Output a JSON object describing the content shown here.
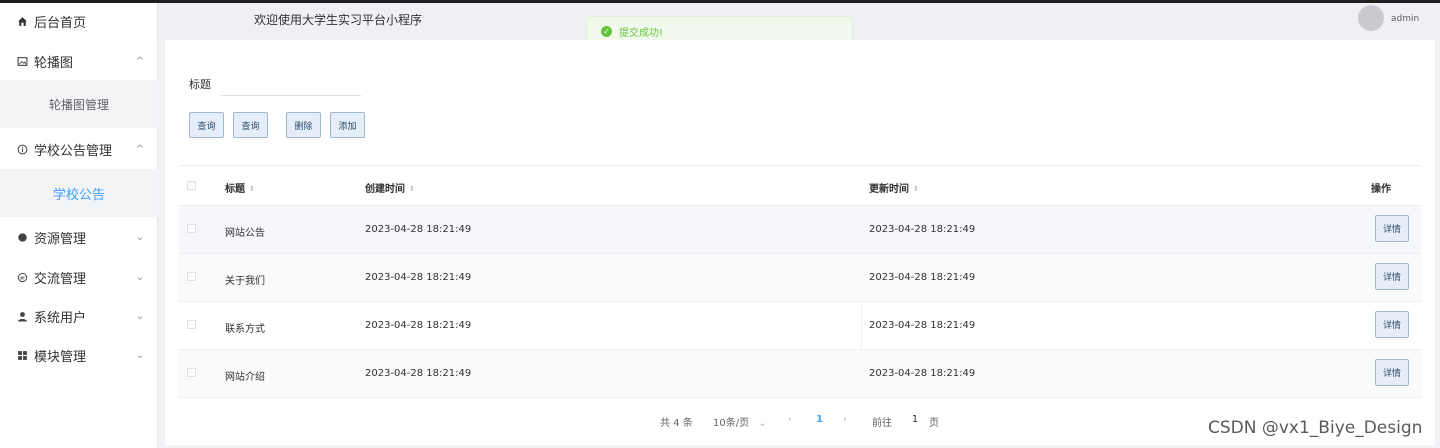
{
  "sidebar": {
    "items": [
      {
        "label": "后台首页",
        "icon": "home-icon"
      },
      {
        "label": "轮播图",
        "icon": "image-icon"
      },
      {
        "label": "轮播图管理"
      },
      {
        "label": "学校公告管理",
        "icon": "info-icon"
      },
      {
        "label": "学校公告"
      },
      {
        "label": "资源管理",
        "icon": "resource-icon"
      },
      {
        "label": "交流管理",
        "icon": "chat-icon"
      },
      {
        "label": "系统用户",
        "icon": "user-icon"
      },
      {
        "label": "模块管理",
        "icon": "grid-icon"
      }
    ],
    "chevron_up": "^",
    "chevron_down": "⌄"
  },
  "header": {
    "title": "欢迎使用大学生实习平台小程序",
    "user": "admin"
  },
  "toast": {
    "message": "提交成功!",
    "icon": "✓"
  },
  "search": {
    "label": "标题",
    "value": ""
  },
  "buttons": {
    "reset": "查询",
    "query": "查询",
    "delete": "删除",
    "add": "添加"
  },
  "table": {
    "headers": {
      "title": "标题",
      "created": "创建时间",
      "updated": "更新时间",
      "actions": "操作"
    },
    "sort_icon": "⇕",
    "rows": [
      {
        "title": "网站公告",
        "created": "2023-04-28 18:21:49",
        "updated": "2023-04-28 18:21:49",
        "action": "详情"
      },
      {
        "title": "关于我们",
        "created": "2023-04-28 18:21:49",
        "updated": "2023-04-28 18:21:49",
        "action": "详情"
      },
      {
        "title": "联系方式",
        "created": "2023-04-28 18:21:49",
        "updated": "2023-04-28 18:21:49",
        "action": "详情"
      },
      {
        "title": "网站介绍",
        "created": "2023-04-28 18:21:49",
        "updated": "2023-04-28 18:21:49",
        "action": "详情"
      }
    ]
  },
  "pagination": {
    "total": "共 4 条",
    "page_size": "10条/页",
    "prev": "‹",
    "current": "1",
    "next": "›",
    "goto_prefix": "前往",
    "goto_value": "1",
    "goto_suffix": "页",
    "dropdown": "⌄"
  },
  "watermark": "CSDN @vx1_Biye_Design",
  "colors": {
    "accent": "#409eff",
    "success": "#67c23a",
    "button_bg": "#e5eef8"
  }
}
